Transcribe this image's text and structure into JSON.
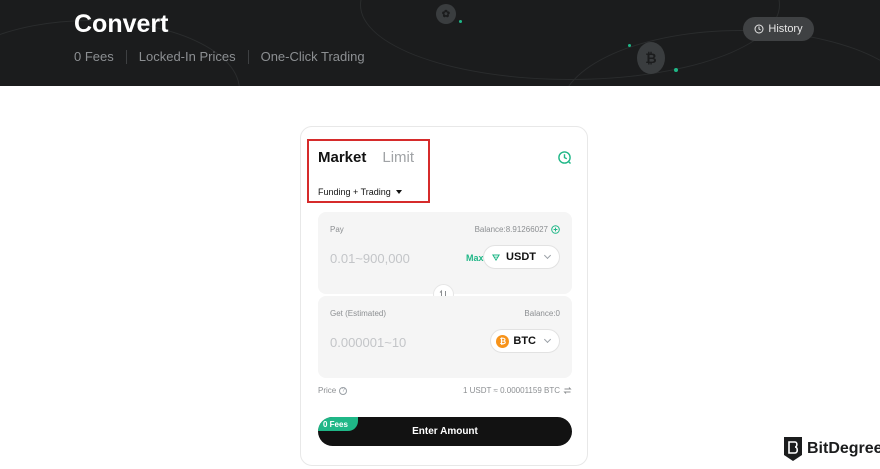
{
  "header": {
    "title": "Convert",
    "features": [
      "0 Fees",
      "Locked-In Prices",
      "One-Click Trading"
    ],
    "history_label": "History"
  },
  "tabs": {
    "market": "Market",
    "limit": "Limit"
  },
  "account": {
    "selected": "Funding + Trading"
  },
  "pay": {
    "label": "Pay",
    "balance": "Balance:8.91266027",
    "placeholder": "0.01~900,000",
    "max_label": "Max",
    "coin": "USDT"
  },
  "get": {
    "label": "Get (Estimated)",
    "balance": "Balance:0",
    "placeholder": "0.000001~10",
    "coin": "BTC"
  },
  "price": {
    "label": "Price",
    "value": "1 USDT ≈ 0.00001159 BTC"
  },
  "action": {
    "fees_badge": "0 Fees",
    "button_label": "Enter Amount"
  },
  "watermark": {
    "brand": "BitDegree"
  },
  "colors": {
    "accent": "#1fb787",
    "highlight": "#d62b2b",
    "dark": "#1b1c1d"
  }
}
